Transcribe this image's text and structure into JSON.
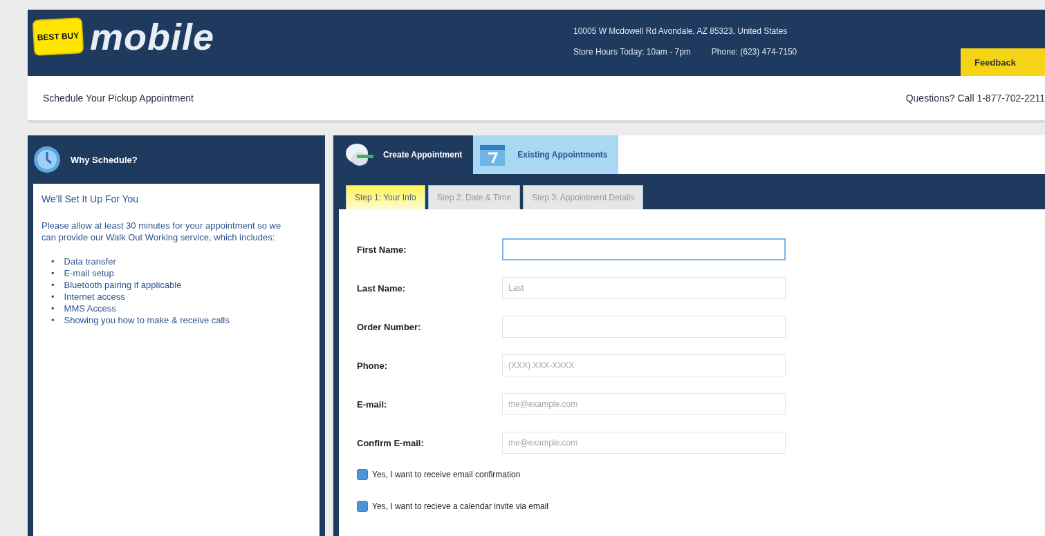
{
  "header": {
    "logo_badge": "BEST BUY",
    "logo_word": "mobile",
    "address": "10005 W Mcdowell Rd Avondale, AZ 85323, United States",
    "store_hours": "Store Hours Today: 10am - 7pm",
    "phone": "Phone: (623) 474-7150",
    "feedback_button": "Feedback"
  },
  "subheader": {
    "title": "Schedule Your Pickup Appointment",
    "questions": "Questions? Call 1-877-702-2211"
  },
  "sidebar": {
    "title": "Why Schedule?",
    "heading": "We'll Set It Up For You",
    "intro": "Please allow at least 30 minutes for your appointment so we can provide our Walk Out Working service, which includes:",
    "items": [
      {
        "bullet": "•",
        "text": "Data transfer"
      },
      {
        "bullet": "•",
        "text": "E-mail setup"
      },
      {
        "bullet": "•",
        "text": "Bluetooth pairing if applicable"
      },
      {
        "bullet": "•",
        "text": "Internet access"
      },
      {
        "bullet": "•",
        "text": "MMS Access"
      },
      {
        "bullet": "•",
        "text": "Showing you how to make & receive calls"
      }
    ]
  },
  "tabs": [
    {
      "label": "Create Appointment",
      "selected": true
    },
    {
      "label": "Existing Appointments",
      "selected": false
    }
  ],
  "steps": [
    {
      "label": "Step 1: Your Info",
      "selected": true
    },
    {
      "label": "Step 2: Date & Time",
      "selected": false
    },
    {
      "label": "Step 3: Appointment Details",
      "selected": false
    }
  ],
  "fields": [
    {
      "label": "First Name:",
      "focused": true
    },
    {
      "label": "Last Name:",
      "placeholder": "Last",
      "focused": false
    },
    {
      "label": "Order Number:",
      "focused": false
    },
    {
      "label": "Phone:",
      "placeholder": "(XXX) XXX-XXXX",
      "focused": false
    },
    {
      "label": "E-mail:",
      "placeholder": "me@example.com",
      "focused": false
    },
    {
      "label": "Confirm E-mail:",
      "placeholder": "me@example.com",
      "focused": false
    }
  ],
  "checkboxes": [
    {
      "label": "Yes, I want to receive email confirmation",
      "checked": true
    },
    {
      "label": "Yes, I want to recieve a calendar invite via email",
      "checked": true
    }
  ]
}
